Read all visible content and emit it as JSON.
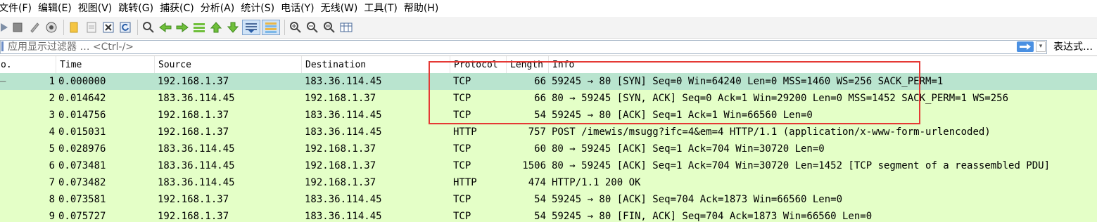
{
  "menu": [
    "文件(F)",
    "编辑(E)",
    "视图(V)",
    "跳转(G)",
    "捕获(C)",
    "分析(A)",
    "统计(S)",
    "电话(Y)",
    "无线(W)",
    "工具(T)",
    "帮助(H)"
  ],
  "toolbar": {
    "icons": [
      "start-capture-icon",
      "stop-capture-icon",
      "restart-capture-icon",
      "capture-options-icon",
      "open-file-icon",
      "save-file-icon",
      "close-file-icon",
      "reload-file-icon",
      "find-packet-icon",
      "go-back-icon",
      "go-forward-icon",
      "go-to-packet-icon",
      "go-first-icon",
      "go-last-icon",
      "autoscroll-icon",
      "colorize-icon",
      "zoom-in-icon",
      "zoom-out-icon",
      "zoom-normal-icon",
      "resize-columns-icon"
    ]
  },
  "filter": {
    "placeholder": "应用显示过滤器 … <Ctrl-/>",
    "expression_label": "表达式…"
  },
  "columns": {
    "no": "o.",
    "time": "Time",
    "source": "Source",
    "destination": "Destination",
    "protocol": "Protocol",
    "length": "Length",
    "info": "Info"
  },
  "packets": [
    {
      "no": "1",
      "time": "0.000000",
      "src": "192.168.1.37",
      "dst": "183.36.114.45",
      "proto": "TCP",
      "len": "66",
      "info": "59245 → 80 [SYN] Seq=0 Win=64240 Len=0 MSS=1460 WS=256 SACK_PERM=1",
      "marker": "—"
    },
    {
      "no": "2",
      "time": "0.014642",
      "src": "183.36.114.45",
      "dst": "192.168.1.37",
      "proto": "TCP",
      "len": "66",
      "info": "80 → 59245 [SYN, ACK] Seq=0 Ack=1 Win=29200 Len=0 MSS=1452 SACK_PERM=1 WS=256",
      "marker": ""
    },
    {
      "no": "3",
      "time": "0.014756",
      "src": "192.168.1.37",
      "dst": "183.36.114.45",
      "proto": "TCP",
      "len": "54",
      "info": "59245 → 80 [ACK] Seq=1 Ack=1 Win=66560 Len=0",
      "marker": ""
    },
    {
      "no": "4",
      "time": "0.015031",
      "src": "192.168.1.37",
      "dst": "183.36.114.45",
      "proto": "HTTP",
      "len": "757",
      "info": "POST /imewis/msugg?ifc=4&em=4 HTTP/1.1  (application/x-www-form-urlencoded)",
      "marker": ""
    },
    {
      "no": "5",
      "time": "0.028976",
      "src": "183.36.114.45",
      "dst": "192.168.1.37",
      "proto": "TCP",
      "len": "60",
      "info": "80 → 59245 [ACK] Seq=1 Ack=704 Win=30720 Len=0",
      "marker": ""
    },
    {
      "no": "6",
      "time": "0.073481",
      "src": "183.36.114.45",
      "dst": "192.168.1.37",
      "proto": "TCP",
      "len": "1506",
      "info": "80 → 59245 [ACK] Seq=1 Ack=704 Win=30720 Len=1452 [TCP segment of a reassembled PDU]",
      "marker": ""
    },
    {
      "no": "7",
      "time": "0.073482",
      "src": "183.36.114.45",
      "dst": "192.168.1.37",
      "proto": "HTTP",
      "len": "474",
      "info": "HTTP/1.1 200 OK",
      "marker": ""
    },
    {
      "no": "8",
      "time": "0.073581",
      "src": "192.168.1.37",
      "dst": "183.36.114.45",
      "proto": "TCP",
      "len": "54",
      "info": "59245 → 80 [ACK] Seq=704 Ack=1873 Win=66560 Len=0",
      "marker": ""
    },
    {
      "no": "9",
      "time": "0.075727",
      "src": "192.168.1.37",
      "dst": "183.36.114.45",
      "proto": "TCP",
      "len": "54",
      "info": "59245 → 80 [FIN, ACK] Seq=704 Ack=1873 Win=66560 Len=0",
      "marker": ""
    }
  ],
  "selected_packet": "1",
  "colors": {
    "row_tcp_http": "#e4ffc7",
    "row_selected": "#b9e4cf",
    "annotation_box": "#e53935"
  }
}
